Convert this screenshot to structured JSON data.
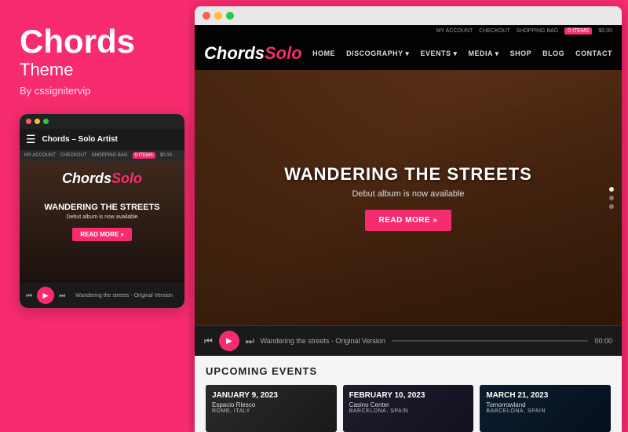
{
  "left": {
    "title": "Chords",
    "subtitle": "Theme",
    "author": "By cssignitervip"
  },
  "mobile": {
    "dots": [
      "red",
      "yellow",
      "green"
    ],
    "nav_title": "Chords – Solo Artist",
    "toplinks": [
      "MY ACCOUNT",
      "CHECKOUT",
      "SHOPPING BAG",
      "0 ITEMS",
      "$0.00"
    ],
    "logo_text": "Chords",
    "logo_suffix": "Solo",
    "hero_title": "WANDERING THE STREETS",
    "hero_sub": "Debut album is now available",
    "read_more": "READ MORE »",
    "player_track": "Wandering the streets - Original Version"
  },
  "browser": {
    "topbar_items": [
      "MY ACCOUNT",
      "CHECKOUT",
      "SHOPPING BAG",
      "0 ITEMS",
      "$0.00"
    ],
    "nav_items": [
      "HOME",
      "DISCOGRAPHY ▾",
      "EVENTS ▾",
      "MEDIA ▾",
      "SHOP",
      "BLOG",
      "CONTACT"
    ],
    "logo_text": "Chords",
    "logo_suffix": "Solo",
    "hero_title": "WANDERING THE STREETS",
    "hero_subtitle": "Debut album is now available",
    "hero_btn": "READ MORE »",
    "player_track": "Wandering the streets - Original Version",
    "player_time": "00:00",
    "events_title": "UPCOMING EVENTS",
    "events": [
      {
        "date": "JANUARY 9, 2023",
        "venue": "Espacio Riesco",
        "city": "ROME, ITALY"
      },
      {
        "date": "FEBRUARY 10, 2023",
        "venue": "Casino Center",
        "city": "BARCELONA, SPAIN"
      },
      {
        "date": "MARCH 21, 2023",
        "venue": "Tomorrowland",
        "city": "BARCELONA, SPAIN"
      }
    ]
  },
  "colors": {
    "accent": "#f72c6e",
    "dark": "#1a1a1a",
    "bg_pink": "#f72c6e"
  }
}
